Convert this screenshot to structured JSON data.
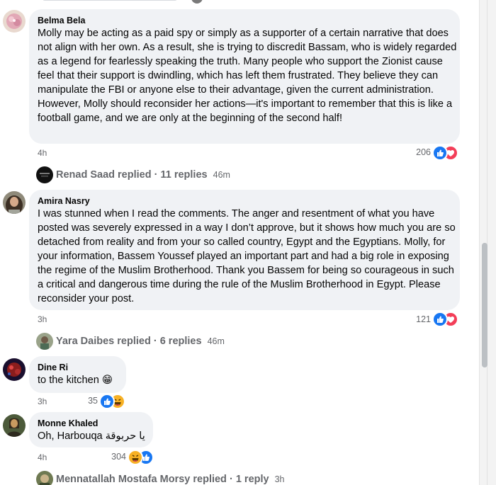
{
  "comments": [
    {
      "author": "Belma Bela",
      "text": "Molly may be acting as a paid spy or simply as a supporter of a certain narrative that does not align with her own. As a result, she is trying to discredit Bassam, who is widely regarded as a legend for fearlessly speaking the truth. Many people who support the Zionist cause feel that their support is dwindling, which has left them frustrated. They believe they can manipulate the FBI or anyone else to their advantage, given the current administration. However, Molly should reconsider her actions—it's important to remember that this is like a football game, and we are only at the beginning of the second half!",
      "time": "4h",
      "reaction_count": "206",
      "reactions": [
        "like-icon",
        "love-icon"
      ],
      "reply_summary": {
        "author": "Renad Saad",
        "replied": "replied",
        "sep": "·",
        "count": "11 replies",
        "time": "46m"
      }
    },
    {
      "author": "Amira Nasry",
      "text": "I was stunned when I read the comments. The anger and resentment of what you have posted was severely expressed in a way I don’t approve, but it shows how much you are so detached from reality and from your so called country, Egypt and the Egyptians. Molly, for your information, Bassem Youssef played an important part and had a big role in exposing the regime of the Muslim Brotherhood. Thank you Bassem for being so courageous in such a critical and dangerous time during the rule of the Muslim Brotherhood in Egypt. Please reconsider your post.",
      "time": "3h",
      "reaction_count": "121",
      "reactions": [
        "like-icon",
        "love-icon"
      ],
      "reply_summary": {
        "author": "Yara Daibes",
        "replied": "replied",
        "sep": "·",
        "count": "6 replies",
        "time": "46m"
      }
    },
    {
      "author": "Dine Ri",
      "text": "to the kitchen",
      "emoji": "😁",
      "time": "3h",
      "reaction_count": "35",
      "reactions": [
        "like-icon",
        "haha-icon"
      ]
    },
    {
      "author": "Monne Khaled",
      "text": "Oh, Harbouqa يا حربوقة",
      "time": "4h",
      "reaction_count": "304",
      "reactions": [
        "haha-icon",
        "like-icon"
      ],
      "reply_summary": {
        "author": "Mennatallah Mostafa Morsy",
        "replied": "replied",
        "sep": "·",
        "count": "1 reply",
        "time": "3h"
      }
    }
  ],
  "colors": {
    "bubble": "#f0f2f5",
    "secondary_text": "#65676b",
    "like_blue": "#1877f2",
    "love_red": "#f33e58",
    "haha_yellow": "#f7b125"
  }
}
